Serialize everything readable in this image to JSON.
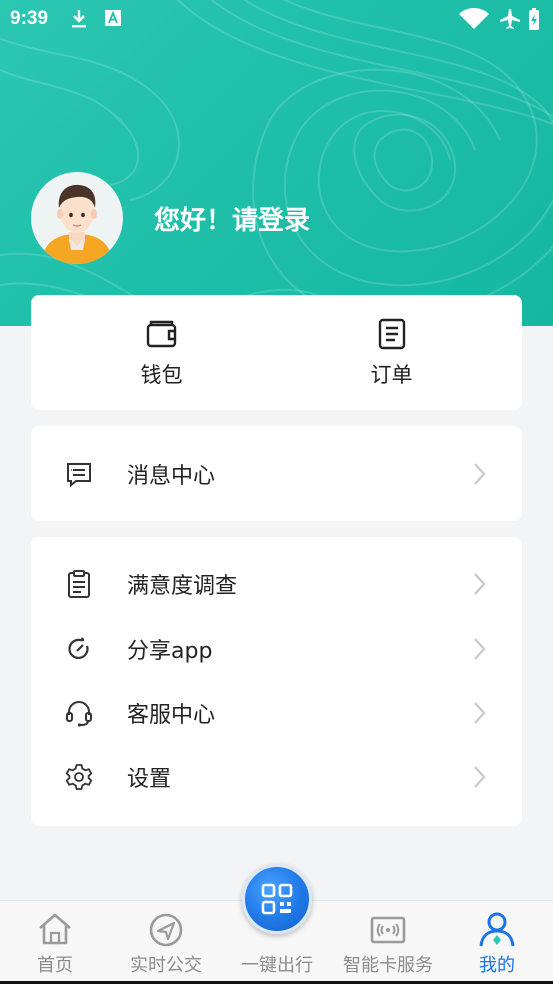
{
  "status_bar": {
    "time": "9:39",
    "icons": [
      "download-icon",
      "a-box-icon",
      "wifi-icon",
      "airplane-icon",
      "battery-charging-icon"
    ]
  },
  "profile": {
    "greeting": "您好！请登录",
    "avatar_icon": "default-avatar"
  },
  "quick_actions": [
    {
      "label": "钱包",
      "icon": "wallet-icon"
    },
    {
      "label": "订单",
      "icon": "order-icon"
    }
  ],
  "message_center": {
    "label": "消息中心",
    "icon": "message-icon"
  },
  "menu": [
    {
      "label": "满意度调查",
      "icon": "clipboard-icon"
    },
    {
      "label": "分享app",
      "icon": "share-icon"
    },
    {
      "label": "客服中心",
      "icon": "headset-icon"
    },
    {
      "label": "设置",
      "icon": "gear-icon"
    }
  ],
  "bottom_nav": [
    {
      "label": "首页",
      "icon": "home-icon",
      "active": false
    },
    {
      "label": "实时公交",
      "icon": "compass-icon",
      "active": false
    },
    {
      "label": "一键出行",
      "icon": "qr-code-icon",
      "active": false
    },
    {
      "label": "智能卡服务",
      "icon": "nfc-card-icon",
      "active": false
    },
    {
      "label": "我的",
      "icon": "user-icon",
      "active": true
    }
  ],
  "colors": {
    "header_teal": "#1fbfa9",
    "active_blue": "#1a73e8",
    "inactive_gray": "#8c8c8c"
  }
}
